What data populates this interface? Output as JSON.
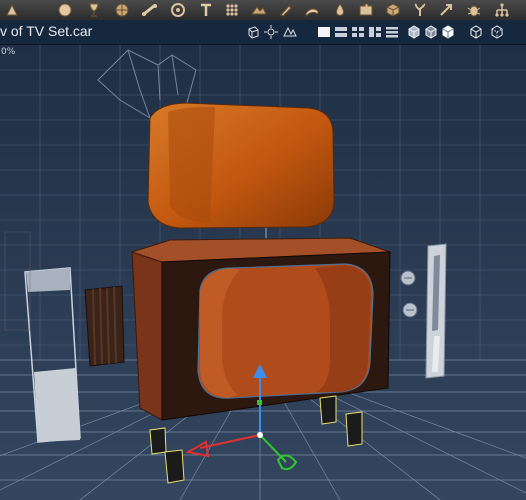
{
  "window": {
    "title": "v of TV Set.car",
    "zoom_readout": "0%"
  },
  "toolbar": {
    "tools": [
      {
        "name": "figure-tool-icon"
      },
      {
        "name": "primitive-sphere-icon"
      },
      {
        "name": "goblet-prop-icon"
      },
      {
        "name": "globe-prop-icon"
      },
      {
        "name": "bone-tool-icon"
      },
      {
        "name": "target-tool-icon"
      },
      {
        "name": "pin-tool-icon"
      },
      {
        "name": "grid-dots-icon"
      },
      {
        "name": "terrain-tool-icon"
      },
      {
        "name": "brush-tool-icon"
      },
      {
        "name": "scroll-tool-icon"
      },
      {
        "name": "drop-tool-icon"
      },
      {
        "name": "puzzle-tool-icon"
      },
      {
        "name": "cube-pattern-icon"
      },
      {
        "name": "plant-tool-icon"
      },
      {
        "name": "arrow-tool-icon"
      },
      {
        "name": "bug-tool-icon"
      },
      {
        "name": "hierarchy-tool-icon"
      }
    ]
  },
  "view_controls": {
    "buttons": [
      {
        "name": "wireframe-cube-icon"
      },
      {
        "name": "lights-icon"
      },
      {
        "name": "render-preview-icon"
      },
      {
        "name": "layout-single-icon"
      },
      {
        "name": "layout-horizontal-icon"
      },
      {
        "name": "layout-quad-icon"
      },
      {
        "name": "layout-vertical-icon"
      },
      {
        "name": "layout-stack-icon"
      },
      {
        "name": "shaded-box-icon"
      },
      {
        "name": "textured-box-icon"
      },
      {
        "name": "lit-box-icon"
      },
      {
        "name": "outline-box-icon"
      },
      {
        "name": "hidden-line-box-icon"
      }
    ]
  },
  "colors": {
    "toolbar_bg": "#3a3a3a",
    "titlebar_bg": "#16283d",
    "viewport_bg": "#2a3a52",
    "grid_line": "#6f86a6",
    "cabinet_brown": "#b5542a",
    "screen_orange": "#c85a12",
    "frame_dark": "#2a1610",
    "gizmo_red": "#e03030",
    "gizmo_blue": "#3a8ef0",
    "gizmo_green": "#2fc62f"
  }
}
